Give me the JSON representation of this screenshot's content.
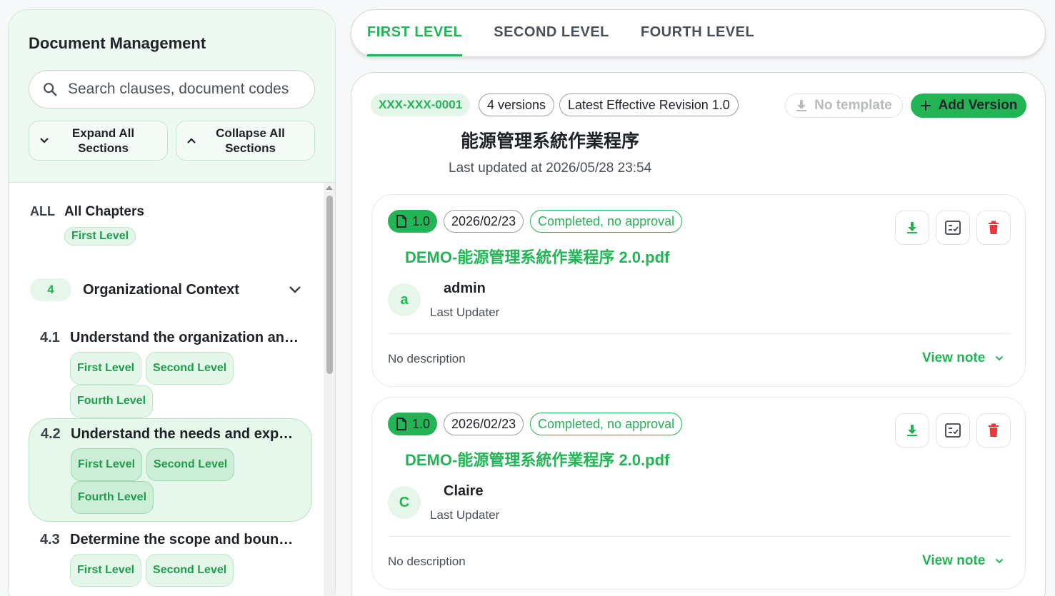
{
  "sidebar": {
    "title": "Document Management",
    "search_placeholder": "Search clauses, document codes",
    "expand_label": "Expand All Sections",
    "collapse_label": "Collapse All Sections",
    "all": {
      "code": "ALL",
      "name": "All Chapters",
      "tags": [
        "First Level"
      ]
    },
    "chapter": {
      "num": "4",
      "name": "Organizational Context"
    },
    "sections": [
      {
        "num": "4.1",
        "title": "Understand the organization and its context",
        "tags": [
          "First Level",
          "Second Level",
          "Fourth Level"
        ]
      },
      {
        "num": "4.2",
        "title": "Understand the needs and expectations of interested parties",
        "tags": [
          "First Level",
          "Second Level",
          "Fourth Level"
        ]
      },
      {
        "num": "4.3",
        "title": "Determine the scope and boundaries",
        "tags": [
          "First Level",
          "Second Level"
        ]
      }
    ]
  },
  "tabs": [
    "FIRST LEVEL",
    "SECOND LEVEL",
    "FOURTH LEVEL"
  ],
  "document": {
    "code": "XXX-XXX-0001",
    "versions_count": "4 versions",
    "latest": "Latest Effective Revision 1.0",
    "no_template": "No template",
    "add_version": "Add Version",
    "title": "能源管理系統作業程序",
    "updated": "Last updated at 2026/05/28 23:54"
  },
  "versions": [
    {
      "ver": "1.0",
      "date": "2026/02/23",
      "status": "Completed, no approval",
      "file": "DEMO-能源管理系統作業程序 2.0.pdf",
      "initial": "a",
      "user": "admin",
      "role": "Last Updater",
      "desc": "No description",
      "note": "View note"
    },
    {
      "ver": "1.0",
      "date": "2026/02/23",
      "status": "Completed, no approval",
      "file": "DEMO-能源管理系統作業程序 2.0.pdf",
      "initial": "C",
      "user": "Claire",
      "role": "Last Updater",
      "desc": "No description",
      "note": "View note"
    }
  ],
  "colors": {
    "accent": "#22b455",
    "danger": "#e5393b"
  }
}
